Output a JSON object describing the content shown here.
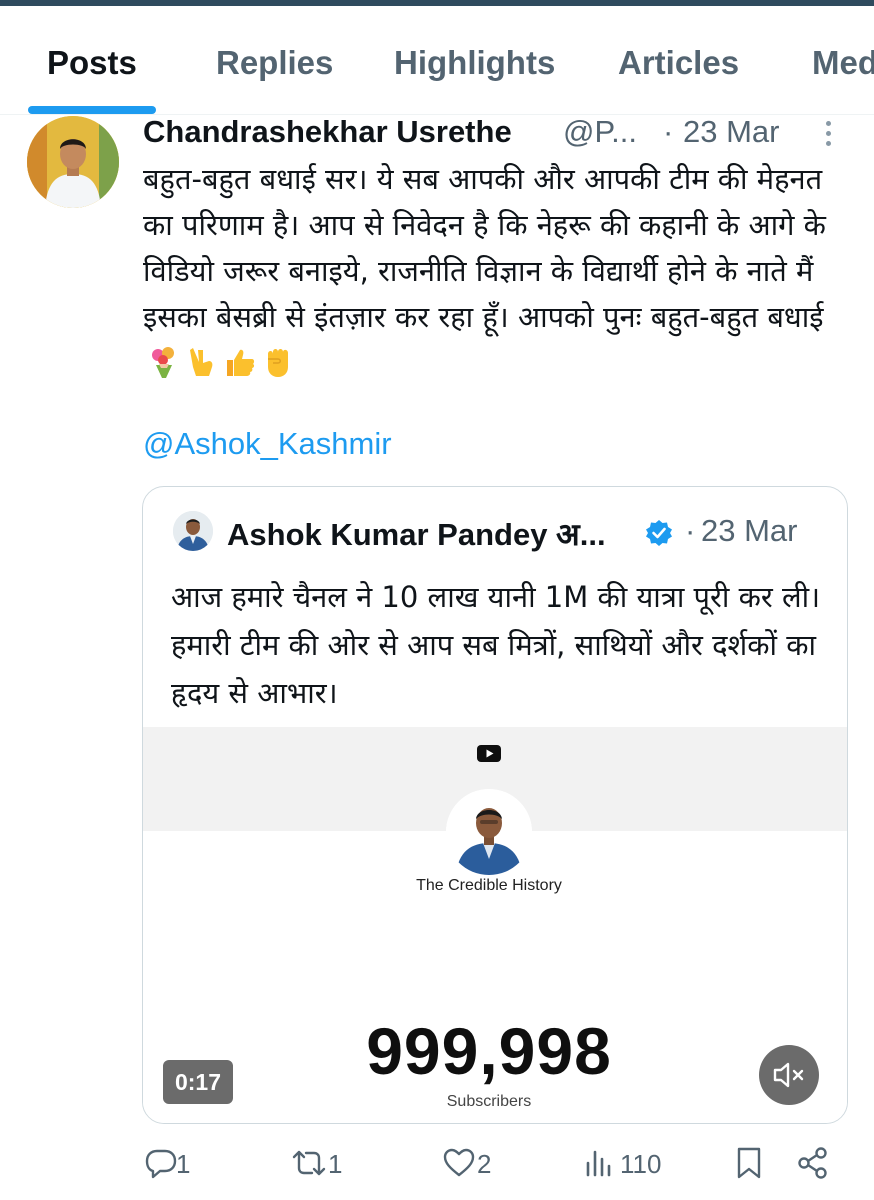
{
  "tabs": [
    "Posts",
    "Replies",
    "Highlights",
    "Articles",
    "Media"
  ],
  "tweet": {
    "author_name": "Chandrashekhar Usrethe",
    "handle": "@P...",
    "date": "23 Mar",
    "dot": "·",
    "text": "बहुत-बहुत बधाई सर। ये सब आपकी और आपकी टीम की मेहनत का परिणाम है। आप से निवेदन है कि नेहरू की कहानी के आगे के विडियो जरूर बनाइये, राजनीति विज्ञान के विद्यार्थी होने के नाते मैं इसका बेसब्री से इंतज़ार कर रहा हूँ। आपको पुनः बहुत-बहुत बधाई",
    "emojis": [
      "bouquet-emoji",
      "victory-hand-emoji",
      "thumbs-up-emoji",
      "raised-fist-emoji"
    ],
    "mention": "@Ashok_Kashmir"
  },
  "quote": {
    "author_name": "Ashok Kumar Pandey अ...",
    "verified": true,
    "date": "23 Mar",
    "dot": "·",
    "text": "आज हमारे चैनल ने 10 लाख यानी 1M की यात्रा पूरी कर ली। हमारी टीम की ओर से आप सब मित्रों, साथियों और दर्शकों का हृदय से आभार।",
    "media": {
      "channel_name": "The Credible History",
      "subscriber_count": "999,998",
      "subscriber_label": "Subscribers",
      "duration": "0:17",
      "muted": true
    }
  },
  "actions": {
    "replies": "1",
    "reposts": "1",
    "likes": "2",
    "views": "110"
  },
  "colors": {
    "accent": "#1d9bf0",
    "text_primary": "#0f1419",
    "text_secondary": "#536471"
  }
}
